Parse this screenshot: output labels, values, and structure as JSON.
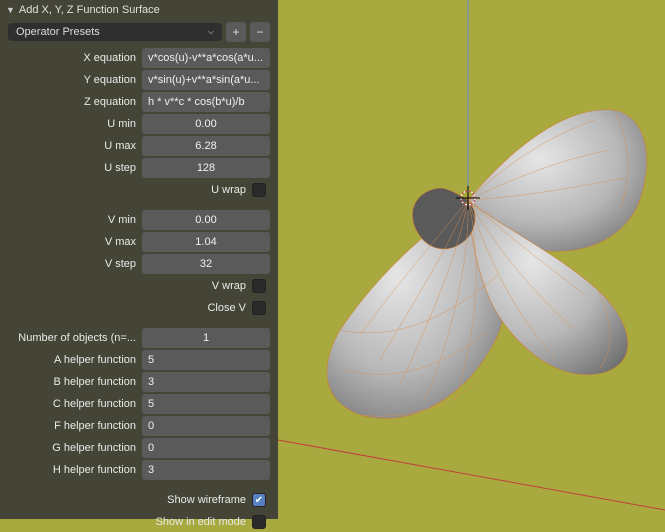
{
  "panel": {
    "title": "Add X, Y, Z Function Surface",
    "preset_label": "Operator Presets",
    "fields": {
      "x_eq_label": "X equation",
      "x_eq_value": "v*cos(u)-v**a*cos(a*u...",
      "y_eq_label": "Y equation",
      "y_eq_value": "v*sin(u)+v**a*sin(a*u...",
      "z_eq_label": "Z equation",
      "z_eq_value": "h * v**c * cos(b*u)/b",
      "u_min_label": "U min",
      "u_min_value": "0.00",
      "u_max_label": "U max",
      "u_max_value": "6.28",
      "u_step_label": "U step",
      "u_step_value": "128",
      "u_wrap_label": "U wrap",
      "v_min_label": "V min",
      "v_min_value": "0.00",
      "v_max_label": "V max",
      "v_max_value": "1.04",
      "v_step_label": "V step",
      "v_step_value": "32",
      "v_wrap_label": "V wrap",
      "close_v_label": "Close V",
      "n_objects_label": "Number of objects (n=...",
      "n_objects_value": "1",
      "a_helper_label": "A helper function",
      "a_helper_value": "5",
      "b_helper_label": "B helper function",
      "b_helper_value": "3",
      "c_helper_label": "C helper function",
      "c_helper_value": "5",
      "f_helper_label": "F helper function",
      "f_helper_value": "0",
      "g_helper_label": "G helper function",
      "g_helper_value": "0",
      "h_helper_label": "H helper function",
      "h_helper_value": "3",
      "show_wire_label": "Show wireframe",
      "show_edit_label": "Show in edit mode"
    },
    "checks": {
      "u_wrap": false,
      "v_wrap": false,
      "close_v": false,
      "show_wireframe": true,
      "show_edit": false
    }
  }
}
